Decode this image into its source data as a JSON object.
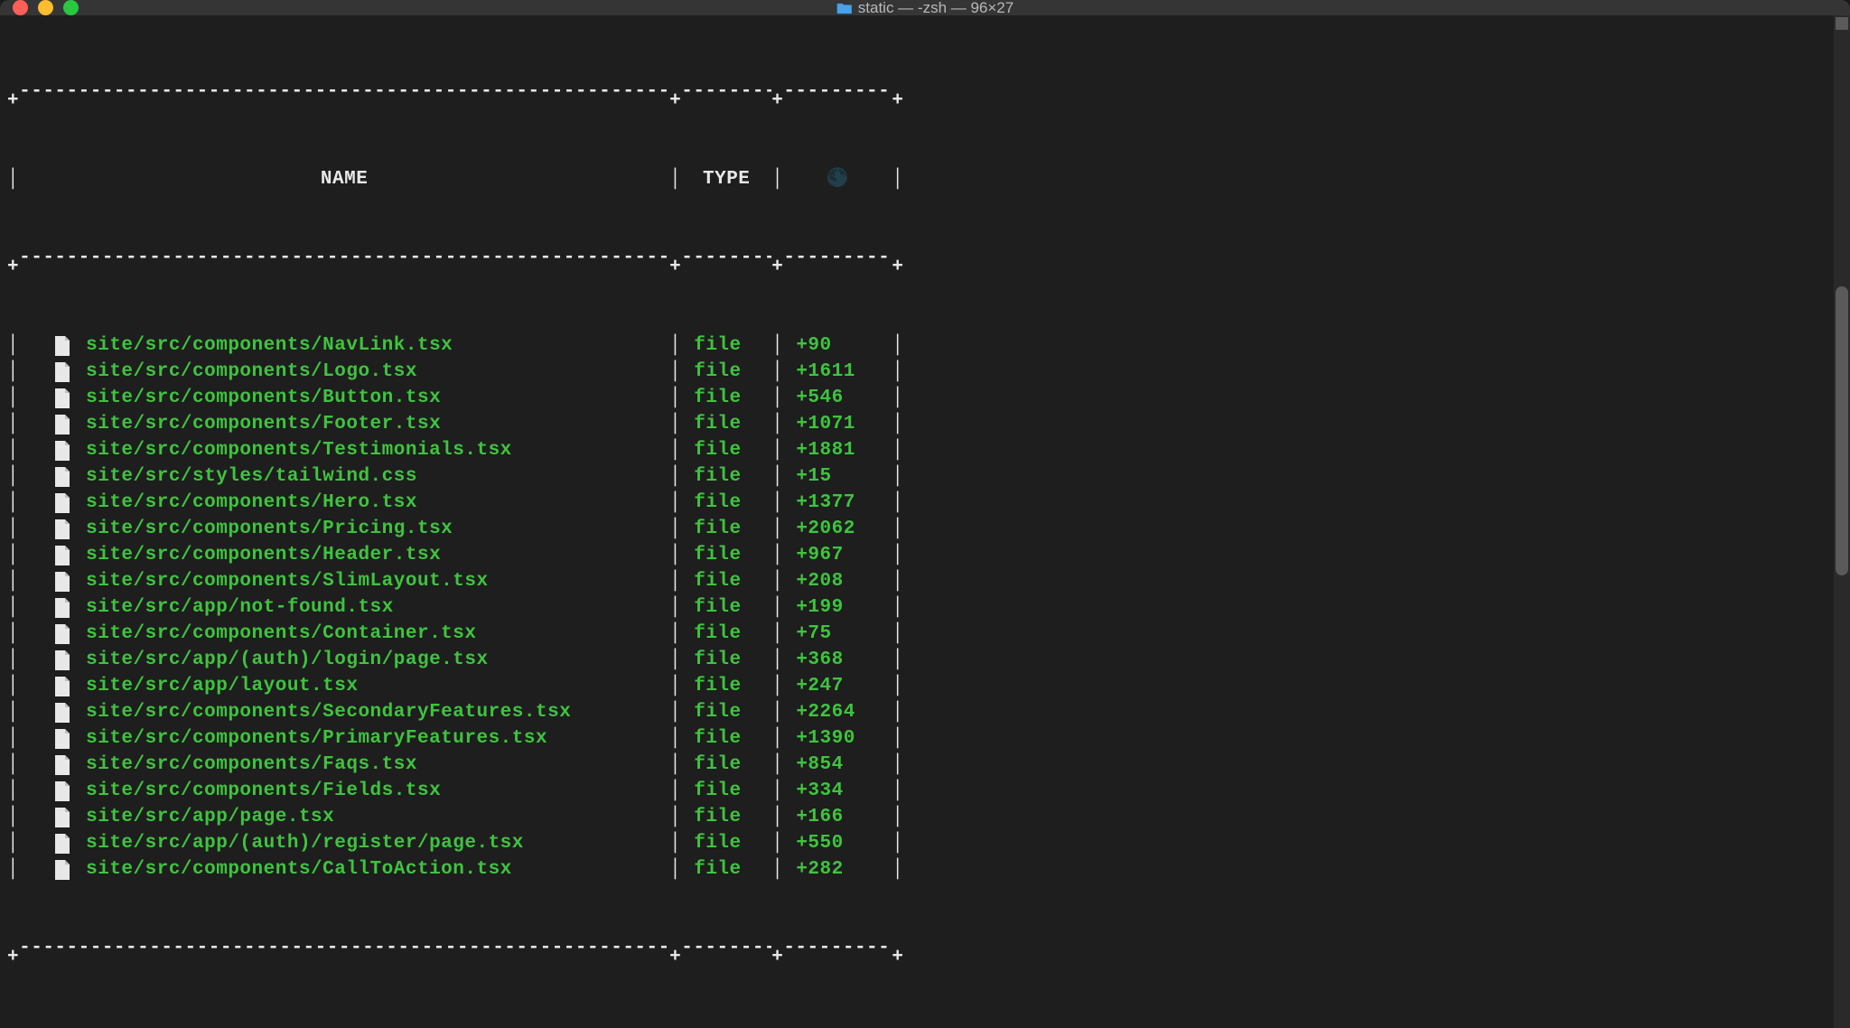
{
  "window": {
    "title": "static — -zsh — 96×27"
  },
  "table": {
    "headers": {
      "name": "NAME",
      "type": "TYPE",
      "count_icon": "🌑"
    },
    "rows": [
      {
        "name": "site/src/components/NavLink.tsx",
        "type": "file",
        "count": "+90"
      },
      {
        "name": "site/src/components/Logo.tsx",
        "type": "file",
        "count": "+1611"
      },
      {
        "name": "site/src/components/Button.tsx",
        "type": "file",
        "count": "+546"
      },
      {
        "name": "site/src/components/Footer.tsx",
        "type": "file",
        "count": "+1071"
      },
      {
        "name": "site/src/components/Testimonials.tsx",
        "type": "file",
        "count": "+1881"
      },
      {
        "name": "site/src/styles/tailwind.css",
        "type": "file",
        "count": "+15"
      },
      {
        "name": "site/src/components/Hero.tsx",
        "type": "file",
        "count": "+1377"
      },
      {
        "name": "site/src/components/Pricing.tsx",
        "type": "file",
        "count": "+2062"
      },
      {
        "name": "site/src/components/Header.tsx",
        "type": "file",
        "count": "+967"
      },
      {
        "name": "site/src/components/SlimLayout.tsx",
        "type": "file",
        "count": "+208"
      },
      {
        "name": "site/src/app/not-found.tsx",
        "type": "file",
        "count": "+199"
      },
      {
        "name": "site/src/components/Container.tsx",
        "type": "file",
        "count": "+75"
      },
      {
        "name": "site/src/app/(auth)/login/page.tsx",
        "type": "file",
        "count": "+368"
      },
      {
        "name": "site/src/app/layout.tsx",
        "type": "file",
        "count": "+247"
      },
      {
        "name": "site/src/components/SecondaryFeatures.tsx",
        "type": "file",
        "count": "+2264"
      },
      {
        "name": "site/src/components/PrimaryFeatures.tsx",
        "type": "file",
        "count": "+1390"
      },
      {
        "name": "site/src/components/Faqs.tsx",
        "type": "file",
        "count": "+854"
      },
      {
        "name": "site/src/components/Fields.tsx",
        "type": "file",
        "count": "+334"
      },
      {
        "name": "site/src/app/page.tsx",
        "type": "file",
        "count": "+166"
      },
      {
        "name": "site/src/app/(auth)/register/page.tsx",
        "type": "file",
        "count": "+550"
      },
      {
        "name": "site/src/components/CallToAction.tsx",
        "type": "file",
        "count": "+282"
      }
    ]
  },
  "borders": {
    "top": "+------------------------------------------------------+-------+---------+",
    "mid": "+------------------------------------------------------+-------+---------+",
    "bottom": "+------------------------------------------------------+-------+---------+"
  }
}
